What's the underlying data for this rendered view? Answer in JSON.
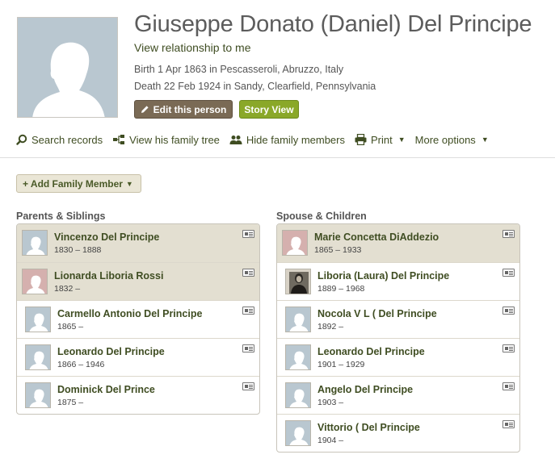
{
  "person": {
    "name": "Giuseppe Donato (Daniel) Del Principe",
    "relationship_link": "View relationship to me",
    "birth": "Birth 1 Apr 1863 in Pescasseroli, Abruzzo, Italy",
    "death": "Death 22 Feb 1924 in Sandy, Clearfield, Pennsylvania",
    "edit_label": "Edit this person",
    "story_label": "Story View"
  },
  "toolbar": {
    "search": "Search records",
    "tree": "View his family tree",
    "hide": "Hide family members",
    "print": "Print",
    "more": "More options"
  },
  "add_member_label": "+ Add Family Member",
  "parents_siblings": {
    "title": "Parents & Siblings",
    "members": [
      {
        "name": "Vincenzo Del Principe",
        "years": "1830 – 1888",
        "gender": "male",
        "highlight": true,
        "indent": false
      },
      {
        "name": "Lionarda Liboria Rossi",
        "years": "1832 –",
        "gender": "female",
        "highlight": true,
        "indent": false
      },
      {
        "name": "Carmello Antonio Del Principe",
        "years": "1865 –",
        "gender": "male",
        "highlight": false,
        "indent": true
      },
      {
        "name": "Leonardo Del Principe",
        "years": "1866 – 1946",
        "gender": "male",
        "highlight": false,
        "indent": true
      },
      {
        "name": "Dominick Del Prince",
        "years": "1875 –",
        "gender": "male",
        "highlight": false,
        "indent": true
      }
    ]
  },
  "spouse_children": {
    "title": "Spouse & Children",
    "members": [
      {
        "name": "Marie Concetta DiAddezio",
        "years": "1865 – 1933",
        "gender": "female",
        "highlight": true,
        "indent": false
      },
      {
        "name": "Liboria (Laura) Del Principe",
        "years": "1889 – 1968",
        "gender": "photo",
        "highlight": false,
        "indent": true
      },
      {
        "name": "Nocola V L ( Del Principe",
        "years": "1892 –",
        "gender": "male",
        "highlight": false,
        "indent": true
      },
      {
        "name": "Leonardo Del Principe",
        "years": "1901 – 1929",
        "gender": "male",
        "highlight": false,
        "indent": true
      },
      {
        "name": "Angelo Del Principe",
        "years": "1903 –",
        "gender": "male",
        "highlight": false,
        "indent": true
      },
      {
        "name": "Vittorio ( Del Principe",
        "years": "1904 –",
        "gender": "male",
        "highlight": false,
        "indent": true
      }
    ]
  }
}
